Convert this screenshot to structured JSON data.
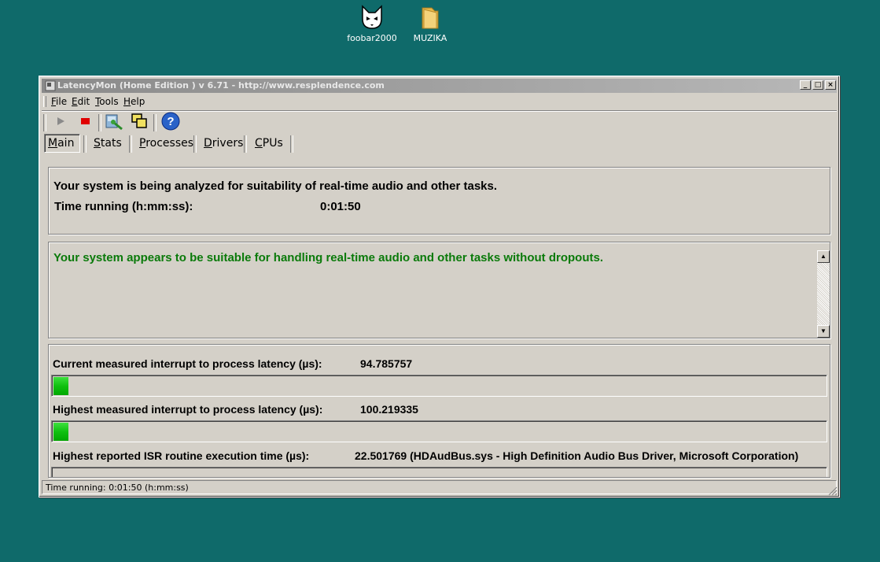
{
  "desktop": {
    "icons": [
      {
        "label": "foobar2000",
        "icon": "foobar-icon"
      },
      {
        "label": "MUZIKA",
        "icon": "folder-icon"
      }
    ]
  },
  "window": {
    "title": "LatencyMon  (Home Edition )  v 6.71 - http://www.resplendence.com",
    "controls": {
      "minimize": "_",
      "maximize": "□",
      "close": "×"
    }
  },
  "menu": {
    "items": [
      {
        "mnemonic": "F",
        "rest": "ile"
      },
      {
        "mnemonic": "E",
        "rest": "dit"
      },
      {
        "mnemonic": "T",
        "rest": "ools"
      },
      {
        "mnemonic": "H",
        "rest": "elp"
      }
    ]
  },
  "toolbar": {
    "buttons": [
      "play-icon",
      "stop-icon",
      "analyze-icon",
      "windows-icon",
      "help-icon"
    ],
    "help_glyph": "?"
  },
  "tabs": {
    "items": [
      {
        "mnemonic": "M",
        "rest": "ain",
        "active": true
      },
      {
        "mnemonic": "S",
        "rest": "tats",
        "active": false
      },
      {
        "mnemonic": "P",
        "rest": "rocesses",
        "active": false
      },
      {
        "mnemonic": "D",
        "rest": "rivers",
        "active": false
      },
      {
        "mnemonic": "C",
        "rest": "PUs",
        "active": false
      }
    ]
  },
  "status_panel": {
    "message": "Your system is being analyzed for suitability of real-time audio and other tasks.",
    "time_label": "Time running (h:mm:ss):",
    "time_value": "0:01:50"
  },
  "verdict_panel": {
    "message": "Your system appears to be suitable for handling real-time audio and other tasks without dropouts.",
    "color": "#0a7a0a"
  },
  "metrics": {
    "current_latency": {
      "label": "Current measured interrupt to process latency (µs):",
      "value": "94.785757",
      "bar_fraction": 0.019
    },
    "highest_latency": {
      "label": "Highest measured interrupt to process latency (µs):",
      "value": "100.219335",
      "bar_fraction": 0.019
    },
    "isr": {
      "label": "Highest reported ISR routine execution time (µs):",
      "value": "22.501769  (HDAudBus.sys - High Definition Audio Bus Driver, Microsoft Corporation)"
    },
    "bar_color": "#10c010"
  },
  "statusbar": {
    "text": "Time running: 0:01:50  (h:mm:ss)"
  }
}
